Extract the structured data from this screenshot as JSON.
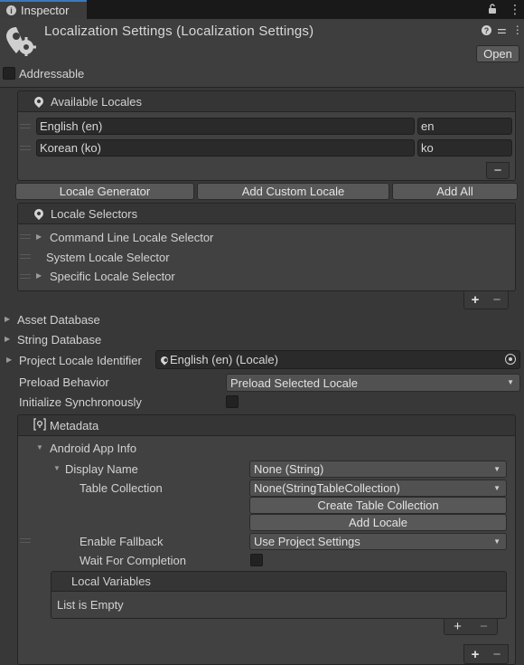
{
  "tab": {
    "title": "Inspector",
    "lock_icon": "lock-icon",
    "menu_icon": "kebab-icon"
  },
  "header": {
    "title": "Localization Settings (Localization Settings)",
    "open_button": "Open",
    "help_icon": "?",
    "settings_icon": "⚌",
    "more_icon": "⋮"
  },
  "addressable": {
    "label": "Addressable",
    "checked": false
  },
  "available_locales": {
    "title": "Available Locales",
    "rows": [
      {
        "name": "English (en)",
        "code": "en"
      },
      {
        "name": "Korean (ko)",
        "code": "ko"
      }
    ],
    "remove_button": "−"
  },
  "locale_buttons": {
    "generator": "Locale Generator",
    "add_custom": "Add Custom Locale",
    "add_all": "Add All"
  },
  "locale_selectors": {
    "title": "Locale Selectors",
    "items": [
      "Command Line Locale Selector",
      "System Locale Selector",
      "Specific Locale Selector"
    ],
    "add": "+",
    "remove": "−"
  },
  "foldouts": {
    "asset_database": "Asset Database",
    "string_database": "String Database"
  },
  "project_locale": {
    "label": "Project Locale Identifier",
    "value": "English (en) (Locale)"
  },
  "preload": {
    "label": "Preload Behavior",
    "value": "Preload Selected Locale"
  },
  "init_sync": {
    "label": "Initialize Synchronously",
    "checked": false
  },
  "metadata": {
    "title": "Metadata",
    "android": "Android App Info",
    "display_name": {
      "label": "Display Name",
      "value": "None (String)"
    },
    "table_collection": {
      "label": "Table Collection",
      "value": "None(StringTableCollection)"
    },
    "create_table": "Create Table Collection",
    "add_locale": "Add Locale",
    "enable_fallback": {
      "label": "Enable Fallback",
      "value": "Use Project Settings"
    },
    "wait": {
      "label": "Wait For Completion",
      "checked": false
    },
    "local_variables": {
      "title": "Local Variables",
      "empty": "List is Empty",
      "add": "+",
      "remove": "−"
    },
    "add": "+",
    "remove": "−"
  },
  "colors": {
    "background": "#383838",
    "tab_accent": "#3a79bb",
    "field": "#2a2a2a",
    "button": "#585858"
  }
}
